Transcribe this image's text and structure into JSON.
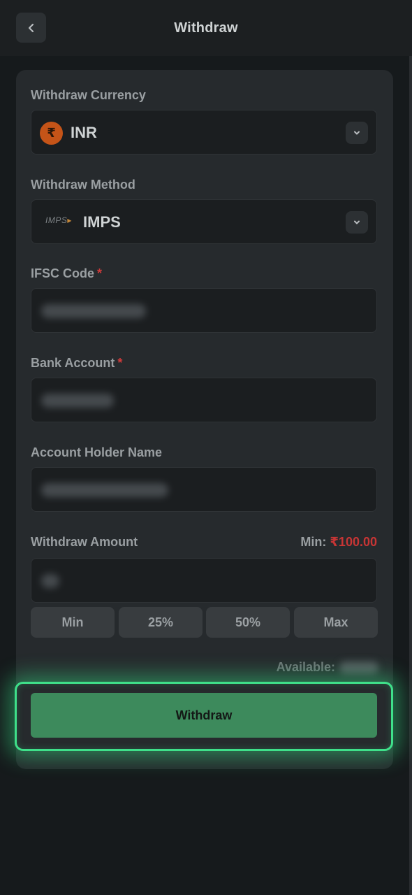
{
  "header": {
    "title": "Withdraw",
    "back_icon": "chevron-left-icon"
  },
  "currency": {
    "label": "Withdraw Currency",
    "value": "INR",
    "icon_symbol": "₹",
    "icon_color": "#c55418"
  },
  "method": {
    "label": "Withdraw Method",
    "logo_text": "IMPS",
    "value": "IMPS"
  },
  "ifsc": {
    "label": "IFSC Code",
    "required_mark": "*"
  },
  "bank_account": {
    "label": "Bank Account",
    "required_mark": "*"
  },
  "holder_name": {
    "label": "Account Holder Name"
  },
  "amount": {
    "label": "Withdraw Amount",
    "min_label": "Min:",
    "min_value": "₹100.00",
    "presets": [
      "Min",
      "25%",
      "50%",
      "Max"
    ]
  },
  "available": {
    "label": "Available:"
  },
  "submit": {
    "label": "Withdraw"
  },
  "colors": {
    "accent_green": "#3d8a5c",
    "glow": "#3fe08a",
    "error_red": "#c73535",
    "background": "#161a1c"
  }
}
